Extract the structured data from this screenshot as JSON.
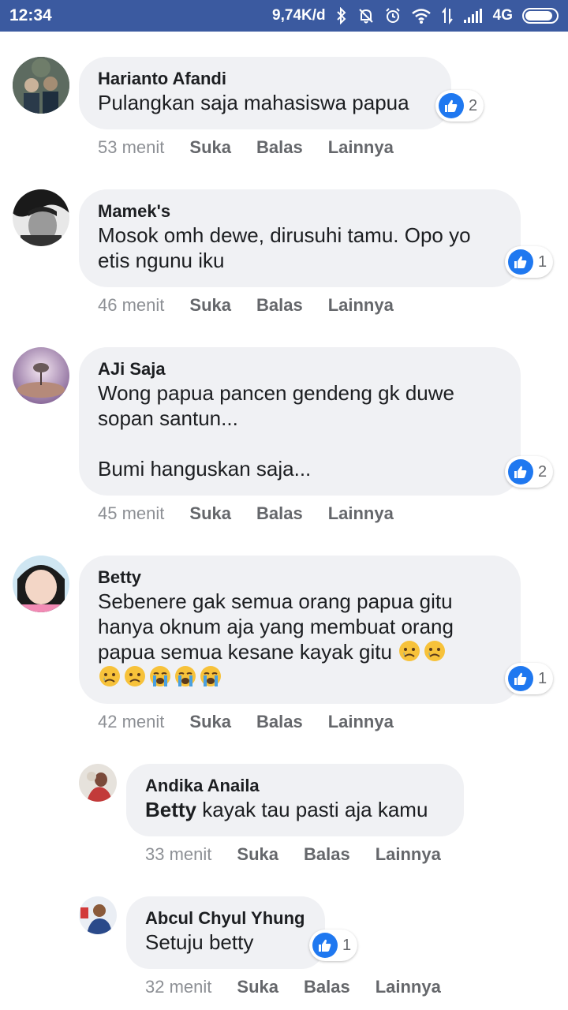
{
  "status_bar": {
    "time": "12:34",
    "speed": "9,74K/d",
    "network": "4G"
  },
  "comments": [
    {
      "author": "Harianto Afandi",
      "text": "Pulangkan saja mahasiswa papua",
      "time": "53 menit",
      "like": "Suka",
      "reply": "Balas",
      "more": "Lainnya",
      "reactions": "2"
    },
    {
      "author": "Mamek's",
      "text": "Mosok omh dewe, dirusuhi tamu. Opo yo\netis ngunu iku",
      "time": "46 menit",
      "like": "Suka",
      "reply": "Balas",
      "more": "Lainnya",
      "reactions": "1"
    },
    {
      "author": "AJi Saja",
      "text": "Wong papua pancen gendeng gk duwe\nsopan santun...\n\nBumi hanguskan saja...",
      "time": "45 menit",
      "like": "Suka",
      "reply": "Balas",
      "more": "Lainnya",
      "reactions": "2"
    },
    {
      "author": "Betty",
      "text": "Sebenere gak semua orang papua gitu\nhanya oknum aja yang membuat orang\npapua semua kesane kayak gitu",
      "time": "42 menit",
      "like": "Suka",
      "reply": "Balas",
      "more": "Lainnya",
      "reactions": "1"
    }
  ],
  "replies": [
    {
      "author": "Andika Anaila",
      "mention": "Betty",
      "text": "kayak tau pasti aja kamu",
      "time": "33 menit",
      "like": "Suka",
      "reply": "Balas",
      "more": "Lainnya"
    },
    {
      "author": "Abcul Chyul Yhung",
      "text": "Setuju betty",
      "time": "32 menit",
      "like": "Suka",
      "reply": "Balas",
      "more": "Lainnya",
      "reactions": "1"
    }
  ],
  "colors": {
    "status_bar": "#3b5aa0",
    "bubble": "#f0f1f4",
    "like_blue": "#1f78f0"
  }
}
